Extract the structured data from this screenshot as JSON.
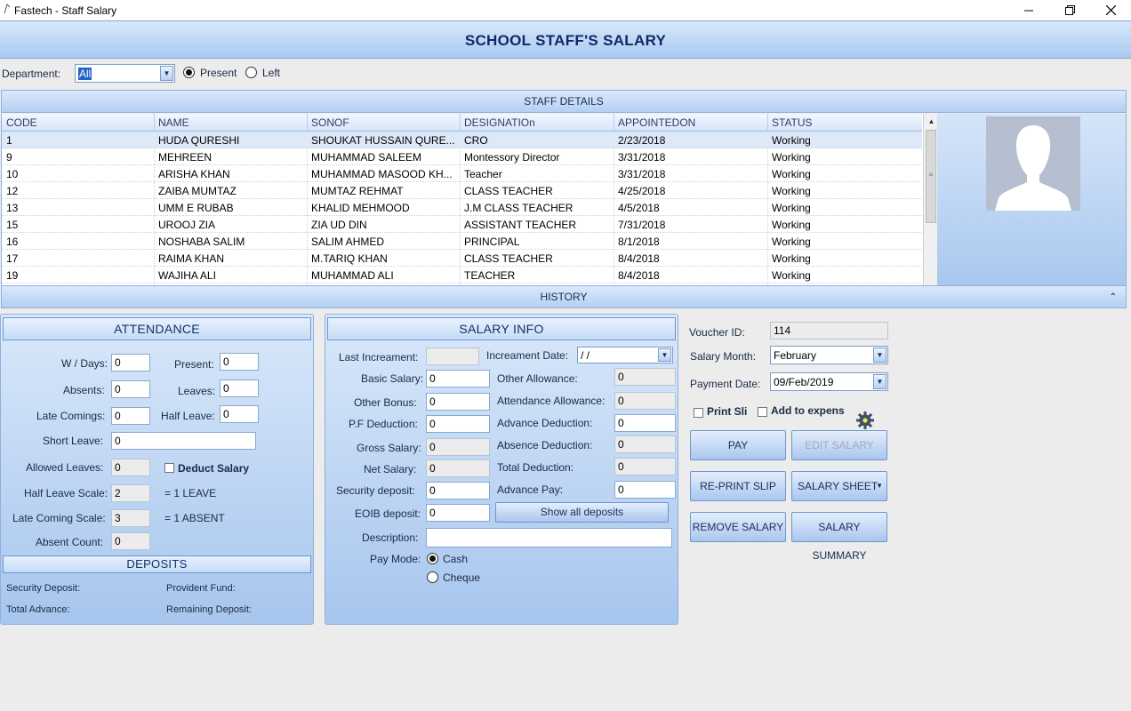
{
  "window": {
    "title": "Fastech - Staff Salary"
  },
  "header": {
    "title": "SCHOOL STAFF'S SALARY"
  },
  "filter": {
    "department_label": "Department:",
    "department_value": "All",
    "present_label": "Present",
    "left_label": "Left",
    "selected": "Present"
  },
  "staff_details": {
    "title": "STAFF DETAILS",
    "columns": [
      "CODE",
      "NAME",
      "SONOF",
      "DESIGNATIOn",
      "APPOINTEDON",
      "STATUS"
    ],
    "rows": [
      [
        "1",
        "HUDA QURESHI",
        "SHOUKAT HUSSAIN QURE...",
        "CRO",
        "2/23/2018",
        "Working"
      ],
      [
        "9",
        "MEHREEN",
        "MUHAMMAD SALEEM",
        "Montessory Director",
        "3/31/2018",
        "Working"
      ],
      [
        "10",
        "ARISHA KHAN",
        "MUHAMMAD MASOOD KH...",
        "Teacher",
        "3/31/2018",
        "Working"
      ],
      [
        "12",
        "ZAIBA MUMTAZ",
        "MUMTAZ REHMAT",
        "CLASS TEACHER",
        "4/25/2018",
        "Working"
      ],
      [
        "13",
        "UMM E RUBAB",
        "KHALID MEHMOOD",
        "J.M CLASS TEACHER",
        "4/5/2018",
        "Working"
      ],
      [
        "15",
        "UROOJ ZIA",
        "ZIA UD DIN",
        "ASSISTANT TEACHER",
        "7/31/2018",
        "Working"
      ],
      [
        "16",
        "NOSHABA SALIM",
        "SALIM AHMED",
        "PRINCIPAL",
        "8/1/2018",
        "Working"
      ],
      [
        "17",
        "RAIMA KHAN",
        "M.TARIQ KHAN",
        "CLASS TEACHER",
        "8/4/2018",
        "Working"
      ],
      [
        "19",
        "WAJIHA ALI",
        "MUHAMMAD ALI",
        "TEACHER",
        "8/4/2018",
        "Working"
      ]
    ]
  },
  "history": {
    "title": "HISTORY"
  },
  "attendance": {
    "title": "ATTENDANCE",
    "w_days_label": "W / Days:",
    "w_days": "0",
    "present_label": "Present:",
    "present": "0",
    "absents_label": "Absents:",
    "absents": "0",
    "leaves_label": "Leaves:",
    "leaves": "0",
    "late_comings_label": "Late Comings:",
    "late_comings": "0",
    "half_leave_label": "Half Leave:",
    "half_leave": "0",
    "short_leave_label": "Short Leave:",
    "short_leave": "0",
    "allowed_leaves_label": "Allowed Leaves:",
    "allowed_leaves": "0",
    "deduct_salary_label": "Deduct Salary",
    "half_leave_scale_label": "Half Leave Scale:",
    "half_leave_scale": "2",
    "half_leave_scale_unit": "= 1 LEAVE",
    "late_coming_scale_label": "Late Coming Scale:",
    "late_coming_scale": "3",
    "late_coming_scale_unit": "= 1 ABSENT",
    "absent_count_label": "Absent Count:",
    "absent_count": "0"
  },
  "deposits": {
    "title": "DEPOSITS",
    "security_deposit_label": "Security Deposit:",
    "provident_fund_label": "Provident Fund:",
    "total_advance_label": "Total Advance:",
    "remaining_deposit_label": "Remaining Deposit:"
  },
  "salary_info": {
    "title": "SALARY INFO",
    "last_increment_label": "Last Increament:",
    "last_increment": "",
    "increment_date_label": "Increament Date:",
    "increment_date": " /  /",
    "basic_salary_label": "Basic Salary:",
    "basic_salary": "0",
    "other_allowance_label": "Other Allowance:",
    "other_allowance": "0",
    "other_bonus_label": "Other Bonus:",
    "other_bonus": "0",
    "attendance_allowance_label": "Attendance Allowance:",
    "attendance_allowance": "0",
    "pf_deduction_label": "P.F Deduction:",
    "pf_deduction": "0",
    "advance_deduction_label": "Advance Deduction:",
    "advance_deduction": "0",
    "gross_salary_label": "Gross Salary:",
    "gross_salary": "0",
    "absence_deduction_label": "Absence Deduction:",
    "absence_deduction": "0",
    "net_salary_label": "Net Salary:",
    "net_salary": "0",
    "total_deduction_label": "Total Deduction:",
    "total_deduction": "0",
    "security_deposit_label": "Security deposit:",
    "security_deposit": "0",
    "advance_pay_label": "Advance Pay:",
    "advance_pay": "0",
    "eoib_deposit_label": "EOIB deposit:",
    "eoib_deposit": "0",
    "show_all_deposits_label": "Show all deposits",
    "description_label": "Description:",
    "description": "",
    "pay_mode_label": "Pay Mode:",
    "cash_label": "Cash",
    "cheque_label": "Cheque",
    "pay_mode": "Cash"
  },
  "voucher": {
    "voucher_id_label": "Voucher ID:",
    "voucher_id": "114",
    "salary_month_label": "Salary Month:",
    "salary_month": "February",
    "payment_date_label": "Payment Date:",
    "payment_date": "09/Feb/2019",
    "print_slip_label": "Print Sli",
    "add_to_expense_label": "Add to expens"
  },
  "actions": {
    "pay": "PAY",
    "edit_salary": "EDIT SALARY",
    "reprint_slip": "RE-PRINT SLIP",
    "salary_sheet": "SALARY SHEET",
    "remove_salary": "REMOVE SALARY",
    "salary_summary": "SALARY SUMMARY"
  },
  "colors": {
    "accent": "#a9c9f0",
    "header_text": "#0e2a66",
    "panel_border": "#8eb0dc"
  },
  "icons": {
    "settings": "gear-icon",
    "collapse": "chevron-double-up-icon",
    "photo": "avatar-placeholder-icon"
  }
}
